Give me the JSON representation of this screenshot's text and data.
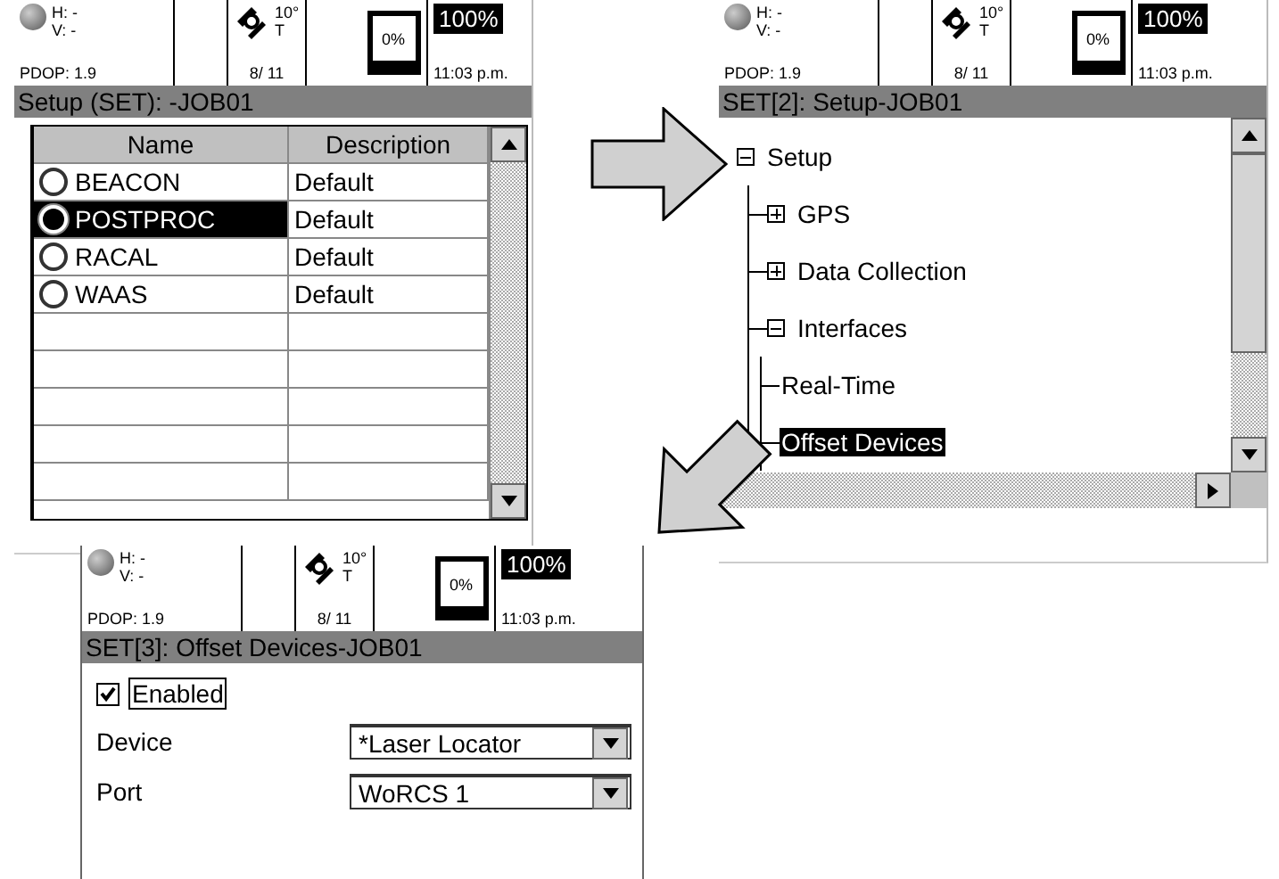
{
  "screens": [
    {
      "kind": "table",
      "status": {
        "h": "H: -",
        "v": "V: -",
        "pdop": "PDOP: 1.9",
        "mask": "10°",
        "mode": "T",
        "sats": "8/ 11",
        "storage": "0%",
        "battery": "100%",
        "time": "11:03 p.m."
      },
      "title": "Setup (SET): -JOB01",
      "columns": [
        "Name",
        "Description"
      ],
      "rows": [
        {
          "name": "BEACON",
          "description": "Default",
          "selected": false
        },
        {
          "name": "POSTPROC",
          "description": "Default",
          "selected": true
        },
        {
          "name": "RACAL",
          "description": "Default",
          "selected": false
        },
        {
          "name": "WAAS",
          "description": "Default",
          "selected": false
        }
      ]
    },
    {
      "kind": "tree",
      "status": {
        "h": "H: -",
        "v": "V: -",
        "pdop": "PDOP: 1.9",
        "mask": "10°",
        "mode": "T",
        "sats": "8/ 11",
        "storage": "0%",
        "battery": "100%",
        "time": "11:03 p.m."
      },
      "title": "SET[2]: Setup-JOB01",
      "tree": [
        {
          "label": "Setup",
          "expanded": true,
          "selected": false,
          "children": [
            {
              "label": "GPS",
              "expanded": false,
              "selected": false
            },
            {
              "label": "Data Collection",
              "expanded": false,
              "selected": false
            },
            {
              "label": "Interfaces",
              "expanded": true,
              "selected": false,
              "children": [
                {
                  "label": "Real-Time",
                  "selected": false
                },
                {
                  "label": "Offset Devices",
                  "selected": true
                }
              ]
            }
          ]
        }
      ]
    },
    {
      "kind": "form",
      "status": {
        "h": "H: -",
        "v": "V: -",
        "pdop": "PDOP: 1.9",
        "mask": "10°",
        "mode": "T",
        "sats": "8/ 11",
        "storage": "0%",
        "battery": "100%",
        "time": "11:03 p.m."
      },
      "title": "SET[3]: Offset Devices-JOB01",
      "enabled": {
        "label": "Enabled",
        "checked": true
      },
      "fields": [
        {
          "label": "Device",
          "value": "*Laser Locator"
        },
        {
          "label": "Port",
          "value": "WoRCS 1"
        }
      ]
    }
  ]
}
